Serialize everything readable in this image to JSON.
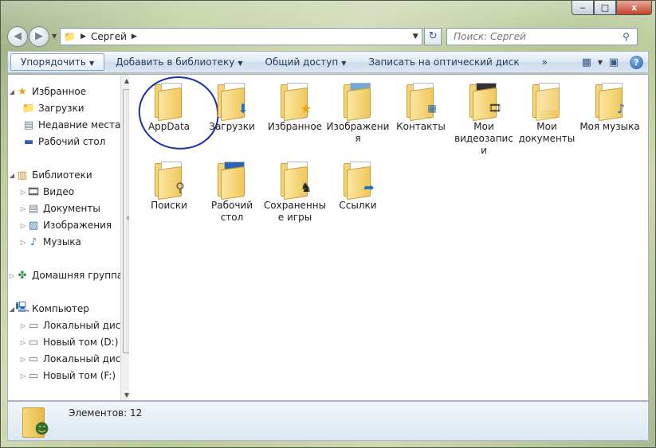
{
  "window": {
    "min_glyph": "‒",
    "max_glyph": "□",
    "close_glyph": "x"
  },
  "nav": {
    "back_glyph": "◀",
    "forward_glyph": "▶"
  },
  "address": {
    "crumb": "Сергей",
    "icon": "folder-user-icon"
  },
  "search": {
    "placeholder": "Поиск: Сергей"
  },
  "toolbar": {
    "organize": "Упорядочить",
    "add_library": "Добавить в библиотеку",
    "share": "Общий доступ",
    "burn": "Записать на оптический диск",
    "more": "»"
  },
  "sidebar": {
    "favorites": "Избранное",
    "downloads": "Загрузки",
    "recent": "Недавние места",
    "desktop": "Рабочий стол",
    "libraries": "Библиотеки",
    "video": "Видео",
    "documents": "Документы",
    "images": "Изображения",
    "music": "Музыка",
    "homegroup": "Домашняя группа",
    "computer": "Компьютер",
    "local_disk_c": "Локальный диск",
    "new_volume_d": "Новый том (D:)",
    "local_disk_2": "Локальный диск",
    "new_volume_f": "Новый том (F:)"
  },
  "items": [
    {
      "label": "AppData",
      "icon": "folder-icon"
    },
    {
      "label": "Загрузки",
      "icon": "downloads-folder-icon"
    },
    {
      "label": "Избранное",
      "icon": "favorites-folder-icon"
    },
    {
      "label": "Изображения",
      "icon": "pictures-folder-icon"
    },
    {
      "label": "Контакты",
      "icon": "contacts-folder-icon"
    },
    {
      "label": "Мои видеозаписи",
      "icon": "videos-folder-icon"
    },
    {
      "label": "Мои документы",
      "icon": "documents-folder-icon"
    },
    {
      "label": "Моя музыка",
      "icon": "music-folder-icon"
    },
    {
      "label": "Поиски",
      "icon": "searches-folder-icon"
    },
    {
      "label": "Рабочий стол",
      "icon": "desktop-folder-icon"
    },
    {
      "label": "Сохраненные игры",
      "icon": "saved-games-folder-icon"
    },
    {
      "label": "Ссылки",
      "icon": "links-folder-icon"
    }
  ],
  "status": {
    "text": "Элементов: 12"
  }
}
